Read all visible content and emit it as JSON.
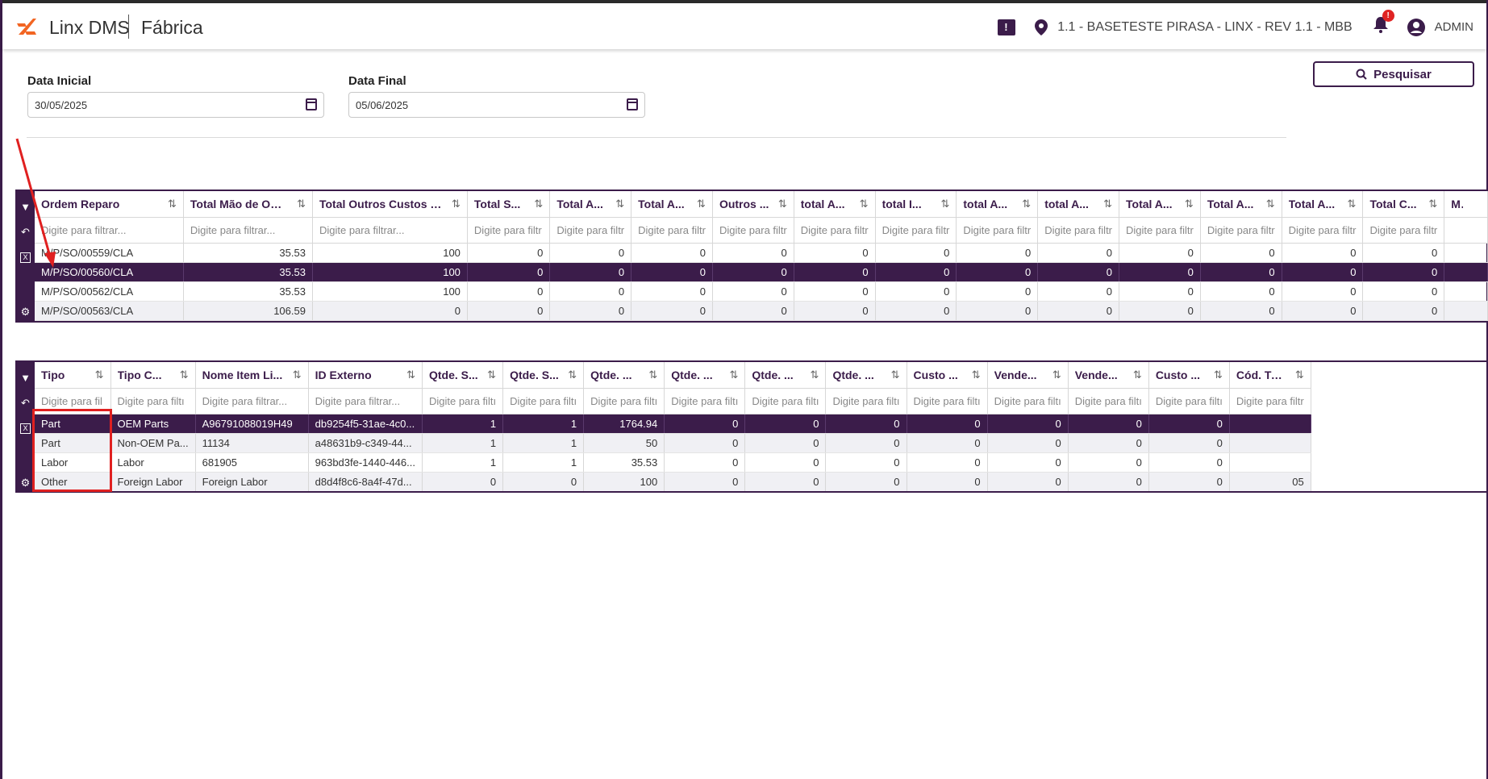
{
  "header": {
    "brand": "Linx DMS",
    "module": "Fábrica",
    "location": "1.1 - BASETESTE PIRASA - LINX - REV 1.1 - MBB",
    "user": "ADMIN",
    "notification_badge": "!",
    "icons": [
      "chat-alert-icon",
      "location-pin-icon",
      "bell-icon",
      "user-circle-icon"
    ]
  },
  "filters": {
    "data_inicial_label": "Data Inicial",
    "data_inicial_value": "30/05/2025",
    "data_final_label": "Data Final",
    "data_final_value": "05/06/2025",
    "search_button": "Pesquisar"
  },
  "colors": {
    "primary": "#3b1c4a",
    "annotation": "#e02020"
  },
  "grid1": {
    "filter_placeholder_long": "Digite para filtrar...",
    "filter_placeholder_short": "Digite para filtr",
    "columns": [
      "Ordem Reparo",
      "Total Mão de Obr...",
      "Total Outros Custos S...",
      "Total S...",
      "Total A...",
      "Total A...",
      "Outros ...",
      "total A...",
      "total I...",
      "total A...",
      "total A...",
      "Total A...",
      "Total A...",
      "Total A...",
      "Total C...",
      "Ma"
    ],
    "rows": [
      [
        "M/P/SO/00559/CLA",
        "35.53",
        "100",
        "0",
        "0",
        "0",
        "0",
        "0",
        "0",
        "0",
        "0",
        "0",
        "0",
        "0",
        "0",
        ""
      ],
      [
        "M/P/SO/00560/CLA",
        "35.53",
        "100",
        "0",
        "0",
        "0",
        "0",
        "0",
        "0",
        "0",
        "0",
        "0",
        "0",
        "0",
        "0",
        ""
      ],
      [
        "M/P/SO/00562/CLA",
        "35.53",
        "100",
        "0",
        "0",
        "0",
        "0",
        "0",
        "0",
        "0",
        "0",
        "0",
        "0",
        "0",
        "0",
        ""
      ],
      [
        "M/P/SO/00563/CLA",
        "106.59",
        "0",
        "0",
        "0",
        "0",
        "0",
        "0",
        "0",
        "0",
        "0",
        "0",
        "0",
        "0",
        "0",
        ""
      ]
    ]
  },
  "grid2": {
    "columns": [
      "Tipo",
      "Tipo C...",
      "Nome Item Li...",
      "ID Externo",
      "Qtde. S...",
      "Qtde. S...",
      "Qtde. ...",
      "Qtde. ...",
      "Qtde. ...",
      "Qtde. ...",
      "Custo ...",
      "Vende...",
      "Vende...",
      "Custo ...",
      "Cód. Tri..."
    ],
    "filters": [
      "Digite para fil",
      "Digite para filtı",
      "Digite para filtrar...",
      "Digite para filtrar...",
      "Digite para filtı",
      "Digite para filtı",
      "Digite para filtı",
      "Digite para filtı",
      "Digite para filtı",
      "Digite para filtı",
      "Digite para filtı",
      "Digite para filtı",
      "Digite para filtı",
      "Digite para filtı",
      "Digite para filtr"
    ],
    "rows": [
      [
        "Part",
        "OEM Parts",
        "A96791088019H49",
        "db9254f5-31ae-4c0...",
        "1",
        "1",
        "1764.94",
        "0",
        "0",
        "0",
        "0",
        "0",
        "0",
        "0",
        ""
      ],
      [
        "Part",
        "Non-OEM Pa...",
        "11134",
        "a48631b9-c349-44...",
        "1",
        "1",
        "50",
        "0",
        "0",
        "0",
        "0",
        "0",
        "0",
        "0",
        ""
      ],
      [
        "Labor",
        "Labor",
        "681905",
        "963bd3fe-1440-446...",
        "1",
        "1",
        "35.53",
        "0",
        "0",
        "0",
        "0",
        "0",
        "0",
        "0",
        ""
      ],
      [
        "Other",
        "Foreign Labor",
        "Foreign Labor",
        "d8d4f8c6-8a4f-47d...",
        "0",
        "0",
        "100",
        "0",
        "0",
        "0",
        "0",
        "0",
        "0",
        "0",
        "05"
      ]
    ]
  }
}
